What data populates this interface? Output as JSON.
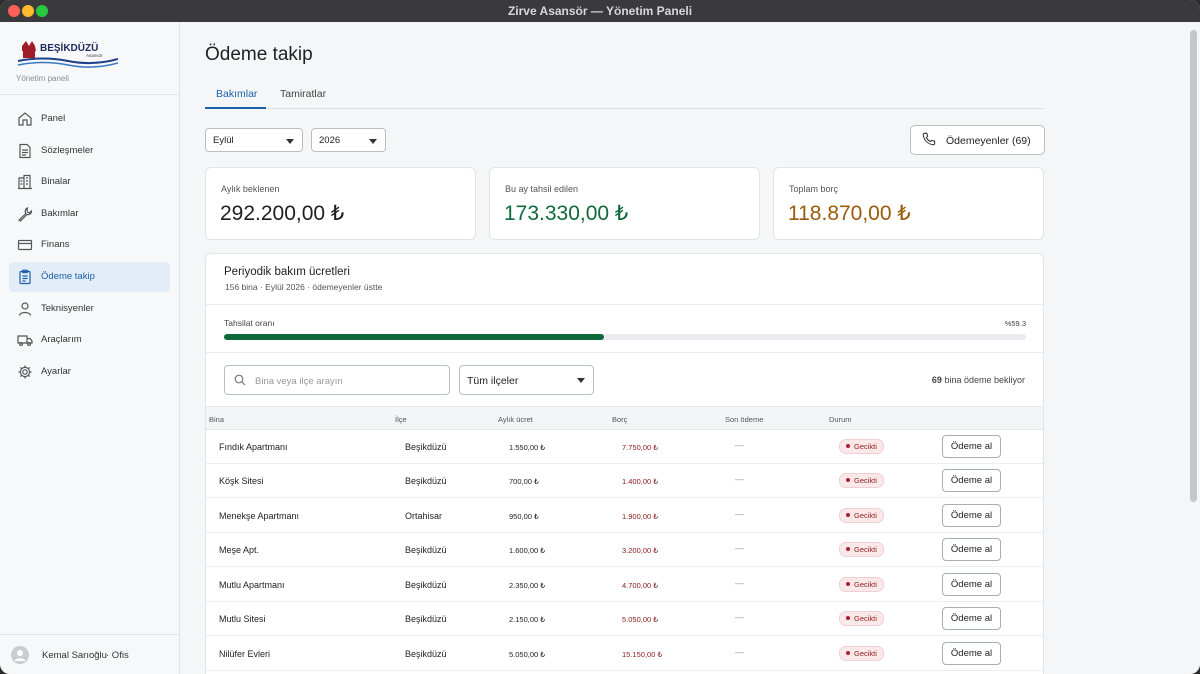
{
  "window": {
    "title": "Zirve Asansör — Yönetim Paneli"
  },
  "brand": {
    "logo_text": "BEŞİKDÜZÜ",
    "logo_sub": "Asansör",
    "subtitle": "Yönetim paneli"
  },
  "sidebar": {
    "items": [
      {
        "label": "Panel",
        "icon": "home-icon",
        "active": false
      },
      {
        "label": "Sözleşmeler",
        "icon": "document-icon",
        "active": false
      },
      {
        "label": "Binalar",
        "icon": "building-icon",
        "active": false
      },
      {
        "label": "Bakımlar",
        "icon": "wrench-icon",
        "active": false
      },
      {
        "label": "Finans",
        "icon": "card-icon",
        "active": false
      },
      {
        "label": "Ödeme takip",
        "icon": "clipboard-icon",
        "active": true
      },
      {
        "label": "Teknisyenler",
        "icon": "person-icon",
        "active": false
      },
      {
        "label": "Araçlarım",
        "icon": "truck-icon",
        "active": false
      },
      {
        "label": "Ayarlar",
        "icon": "gear-icon",
        "active": false
      }
    ],
    "user": {
      "name": "Kemal Sarıoğlu",
      "role": "· Ofis"
    }
  },
  "page": {
    "title": "Ödeme takip",
    "tabs": [
      {
        "label": "Bakımlar",
        "active": true
      },
      {
        "label": "Tamiratlar",
        "active": false
      }
    ],
    "filters": {
      "month": "Eylül",
      "year": "2026"
    },
    "non_payers_button": "Ödemeyenler (69)"
  },
  "stats": [
    {
      "label": "Aylık beklenen",
      "value": "292.200,00 ₺",
      "color": "#1f1f1f"
    },
    {
      "label": "Bu ay tahsil edilen",
      "value": "173.330,00 ₺",
      "color": "#0f6a3a"
    },
    {
      "label": "Toplam borç",
      "value": "118.870,00 ₺",
      "color": "#9a5b0a"
    }
  ],
  "panel": {
    "title": "Periyodik bakım ücretleri",
    "subtitle": "156 bina  · Eylül 2026  · ödemeyenler üstte",
    "collection_label": "Tahsilat oranı",
    "collection_rate_text": "%59.3",
    "collection_rate": 59.3,
    "search_placeholder": "Bina veya ilçe arayın",
    "district_filter": "Tüm ilçeler",
    "waiting_count": "69",
    "waiting_text": " bina ödeme bekliyor"
  },
  "table": {
    "columns": [
      "Bina",
      "İlçe",
      "Aylık ücret",
      "Borç",
      "Son ödeme",
      "Durum"
    ],
    "rows": [
      {
        "building": "Fındık Apartmanı",
        "district": "Beşikdüzü",
        "fee": "1.550,00 ₺",
        "debt": "7.750,00 ₺",
        "last": "—",
        "status": "Gecikti",
        "action": "Ödeme al"
      },
      {
        "building": "Köşk Sitesi",
        "district": "Beşikdüzü",
        "fee": "700,00 ₺",
        "debt": "1.400,00 ₺",
        "last": "—",
        "status": "Gecikti",
        "action": "Ödeme al"
      },
      {
        "building": "Menekşe Apartmanı",
        "district": "Ortahisar",
        "fee": "950,00 ₺",
        "debt": "1.900,00 ₺",
        "last": "—",
        "status": "Gecikti",
        "action": "Ödeme al"
      },
      {
        "building": "Meşe Apt.",
        "district": "Beşikdüzü",
        "fee": "1.600,00 ₺",
        "debt": "3.200,00 ₺",
        "last": "—",
        "status": "Gecikti",
        "action": "Ödeme al"
      },
      {
        "building": "Mutlu Apartmanı",
        "district": "Beşikdüzü",
        "fee": "2.350,00 ₺",
        "debt": "4.700,00 ₺",
        "last": "—",
        "status": "Gecikti",
        "action": "Ödeme al"
      },
      {
        "building": "Mutlu Sitesi",
        "district": "Beşikdüzü",
        "fee": "2.150,00 ₺",
        "debt": "5.050,00 ₺",
        "last": "—",
        "status": "Gecikti",
        "action": "Ödeme al"
      },
      {
        "building": "Nilüfer Evleri",
        "district": "Beşikdüzü",
        "fee": "5.050,00 ₺",
        "debt": "15.150,00 ₺",
        "last": "—",
        "status": "Gecikti",
        "action": "Ödeme al"
      }
    ]
  }
}
